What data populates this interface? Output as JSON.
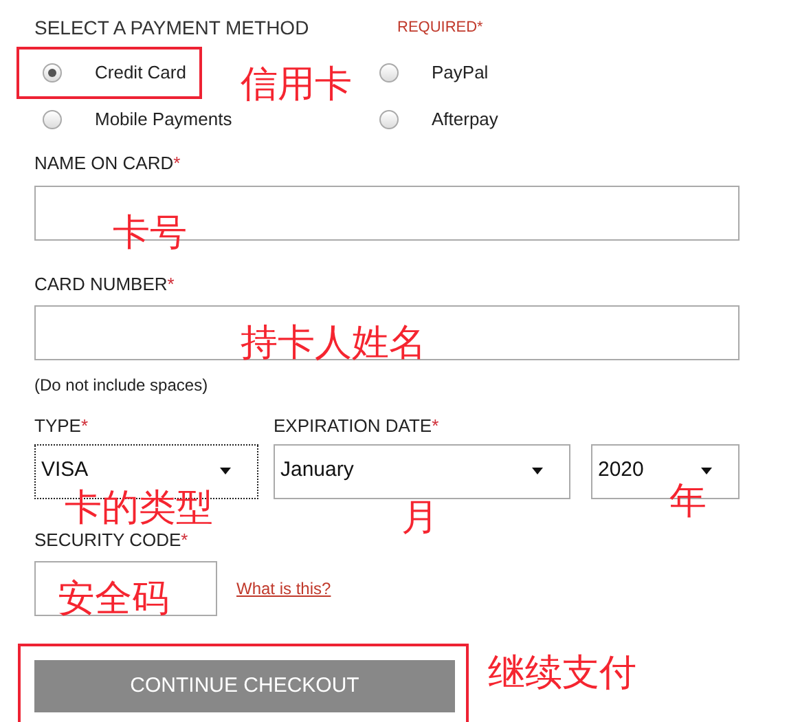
{
  "heading": "SELECT A PAYMENT METHOD",
  "required_note": "REQUIRED*",
  "payment_methods": [
    {
      "label": "Credit Card",
      "selected": true,
      "highlighted": true
    },
    {
      "label": "PayPal",
      "selected": false,
      "highlighted": false
    },
    {
      "label": "Mobile Payments",
      "selected": false,
      "highlighted": false
    },
    {
      "label": "Afterpay",
      "selected": false,
      "highlighted": false
    }
  ],
  "name_on_card": {
    "label": "NAME ON CARD",
    "mark": "*"
  },
  "card_number": {
    "label": "CARD NUMBER",
    "mark": "*",
    "hint": "(Do not include spaces)"
  },
  "type": {
    "label": "TYPE",
    "mark": "*",
    "value": "VISA",
    "focused": true
  },
  "expiration": {
    "label": "EXPIRATION DATE",
    "mark": "*",
    "month": "January",
    "year": "2020"
  },
  "security_code": {
    "label": "SECURITY CODE",
    "mark": "*",
    "link": "What is this?"
  },
  "button": {
    "label": "CONTINUE CHECKOUT",
    "highlighted": true
  },
  "annotations": [
    "信用卡",
    "卡号",
    "持卡人姓名",
    "卡的类型",
    "月",
    "年",
    "安全码",
    "继续支付"
  ]
}
